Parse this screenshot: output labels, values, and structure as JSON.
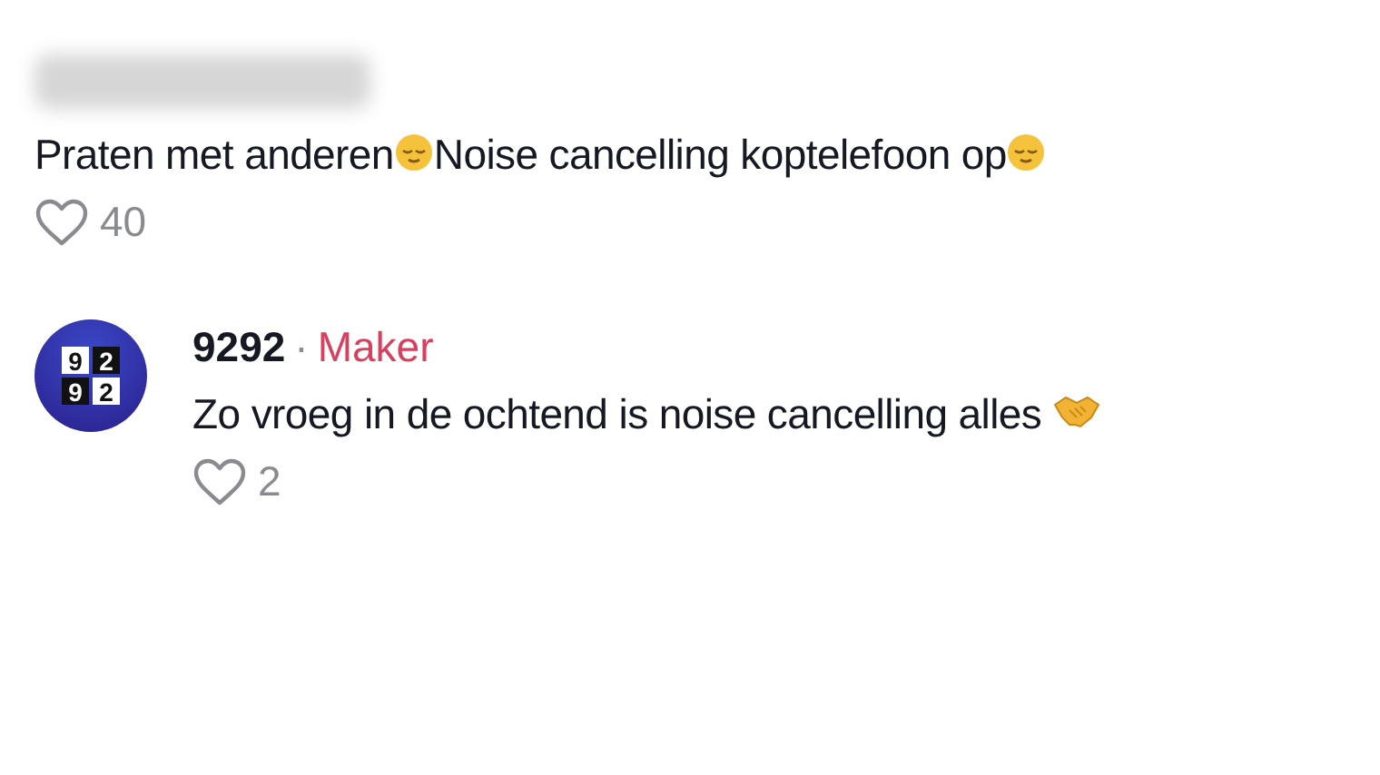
{
  "comments": [
    {
      "author": {
        "redacted": true
      },
      "parts": [
        {
          "kind": "text",
          "text": "Praten met anderen"
        },
        {
          "kind": "relieved"
        },
        {
          "kind": "text",
          "text": "Noise cancelling koptelefoon op"
        },
        {
          "kind": "relieved"
        }
      ],
      "likes": "40"
    },
    {
      "author": {
        "redacted": false,
        "name": "9292",
        "separator": "·",
        "badge": "Maker",
        "avatar_digits": [
          "9",
          "2",
          "9",
          "2"
        ]
      },
      "parts": [
        {
          "kind": "text",
          "text": "Zo vroeg in de ochtend is noise cancelling alles "
        },
        {
          "kind": "handshake"
        }
      ],
      "likes": "2"
    }
  ]
}
